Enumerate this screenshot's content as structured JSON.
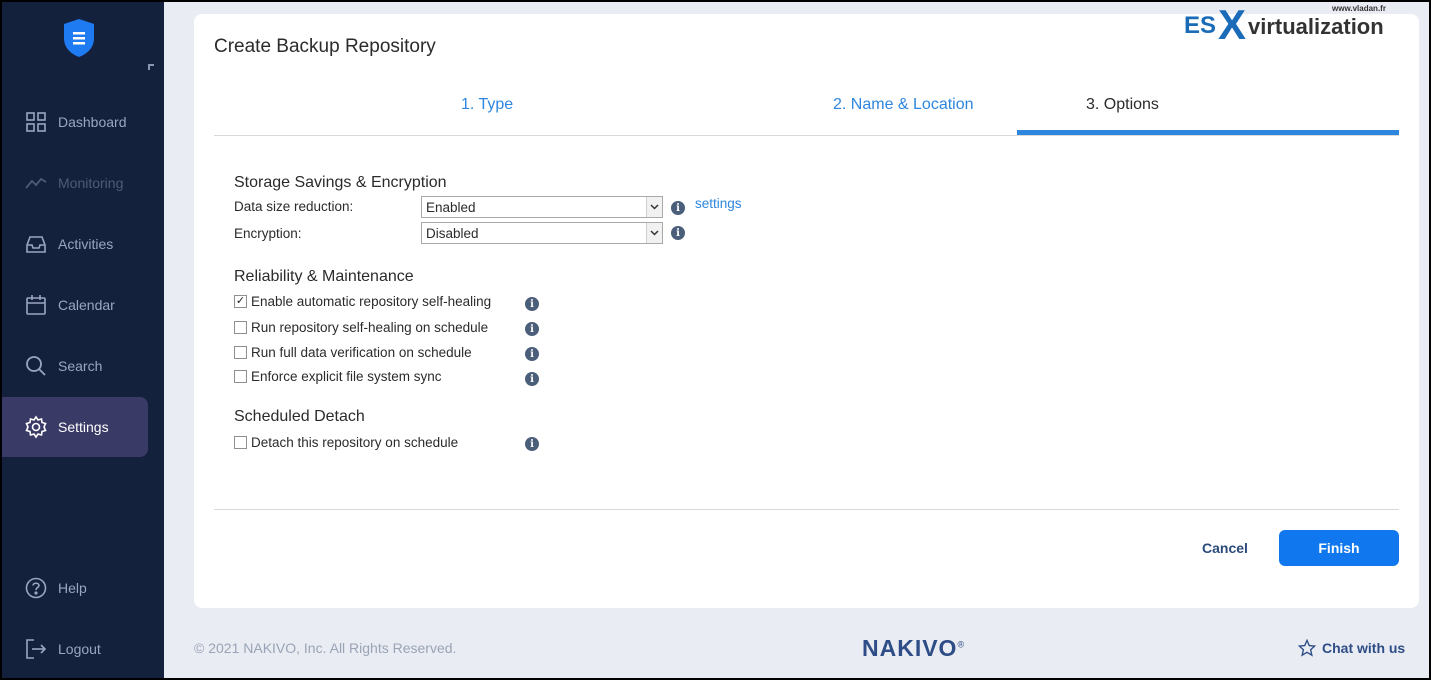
{
  "sidebar": {
    "items": [
      {
        "label": "Dashboard",
        "icon": "grid-icon",
        "state": "normal"
      },
      {
        "label": "Monitoring",
        "icon": "trend-line-icon",
        "state": "disabled"
      },
      {
        "label": "Activities",
        "icon": "inbox-icon",
        "state": "normal"
      },
      {
        "label": "Calendar",
        "icon": "calendar-icon",
        "state": "normal"
      },
      {
        "label": "Search",
        "icon": "search-icon",
        "state": "normal"
      },
      {
        "label": "Settings",
        "icon": "gear-icon",
        "state": "active"
      }
    ],
    "bottom": [
      {
        "label": "Help",
        "icon": "help-circle-icon"
      },
      {
        "label": "Logout",
        "icon": "logout-icon"
      }
    ]
  },
  "dialog": {
    "title": "Create Backup Repository",
    "steps": [
      {
        "label": "1. Type",
        "current": false
      },
      {
        "label": "2. Name & Location",
        "current": false
      },
      {
        "label": "3. Options",
        "current": true
      }
    ],
    "storage": {
      "title": "Storage Savings & Encryption",
      "data_size_label": "Data size reduction:",
      "data_size_value": "Enabled",
      "settings_link": "settings",
      "encryption_label": "Encryption:",
      "encryption_value": "Disabled"
    },
    "reliability": {
      "title": "Reliability & Maintenance",
      "options": [
        {
          "label": "Enable automatic repository self-healing",
          "checked": true
        },
        {
          "label": "Run repository self-healing on schedule",
          "checked": false
        },
        {
          "label": "Run full data verification on schedule",
          "checked": false
        },
        {
          "label": "Enforce explicit file system sync",
          "checked": false
        }
      ]
    },
    "detach": {
      "title": "Scheduled Detach",
      "options": [
        {
          "label": "Detach this repository on schedule",
          "checked": false
        }
      ]
    },
    "cancel_label": "Cancel",
    "finish_label": "Finish"
  },
  "footer": {
    "copyright": "© 2021 NAKIVO, Inc. All Rights Reserved.",
    "brand": "NAKIVO",
    "chat_label": "Chat with us"
  },
  "watermark": {
    "es": "ES",
    "x": "X",
    "virt": "virtualization",
    "url": "www.vladan.fr"
  },
  "colors": {
    "sidebar_bg": "#14213d",
    "accent": "#1177ee",
    "link": "#2e86de",
    "active_nav": "#3a3a66"
  }
}
